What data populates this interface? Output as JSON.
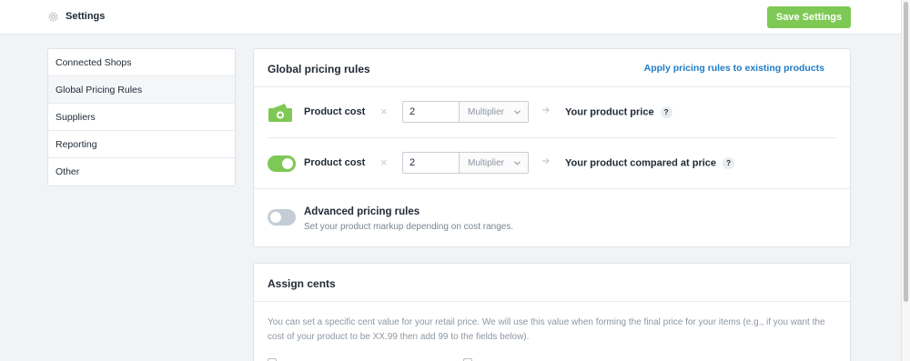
{
  "header": {
    "title": "Settings",
    "save_label": "Save Settings"
  },
  "sidebar": {
    "items": [
      {
        "label": "Connected Shops"
      },
      {
        "label": "Global Pricing Rules"
      },
      {
        "label": "Suppliers"
      },
      {
        "label": "Reporting"
      },
      {
        "label": "Other"
      }
    ],
    "active_index": 1
  },
  "pricing": {
    "title": "Global pricing rules",
    "apply_link": "Apply pricing rules to existing products",
    "rows": [
      {
        "label": "Product cost",
        "operator": "×",
        "value": "2",
        "mode": "Multiplier",
        "result": "Your product price",
        "help": "?"
      },
      {
        "label": "Product cost",
        "operator": "×",
        "value": "2",
        "mode": "Multiplier",
        "result": "Your product compared at price",
        "help": "?"
      }
    ],
    "advanced": {
      "title": "Advanced pricing rules",
      "description": "Set your product markup depending on cost ranges."
    }
  },
  "cents": {
    "title": "Assign cents",
    "description": "You can set a specific cent value for your retail price. We will use this value when forming the final price for your items (e.g., if you want the cost of your product to be XX.99 then add 99 to the fields below)."
  },
  "colors": {
    "accent_green": "#7ec855",
    "link_blue": "#1f7cc7"
  }
}
